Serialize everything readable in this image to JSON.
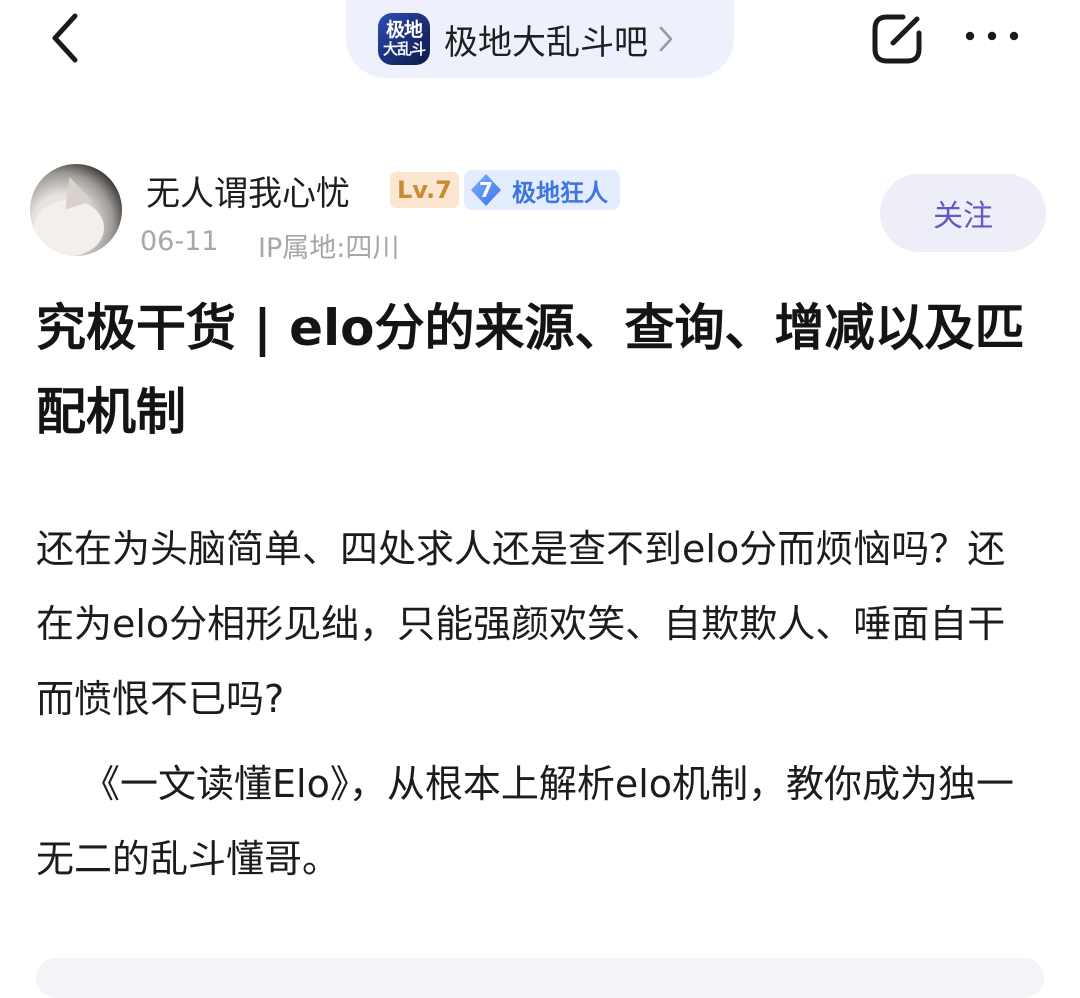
{
  "header": {
    "back_icon": "chevron-left-icon",
    "forum": {
      "logo_line1": "极地",
      "logo_line2": "大乱斗",
      "name": "极地大乱斗吧",
      "chevron_icon": "chevron-right-icon"
    },
    "edit_icon": "share-edit-icon",
    "more_icon": "more-dots-icon"
  },
  "author": {
    "name": "无人谓我心忧",
    "level": "Lv.7",
    "title_badge": {
      "number": "7",
      "text": "极地狂人"
    },
    "date": "06-11",
    "ip_location": "IP属地:四川",
    "follow_label": "关注"
  },
  "post": {
    "title": "究极干货 | elo分的来源、查询、增减以及匹配机制",
    "paragraphs": [
      "还在为头脑简单、四处求人还是查不到elo分而烦恼吗？还在为elo分相形见绌，只能强颜欢笑、自欺欺人、唾面自干而愤恨不已吗?",
      "《一文读懂Elo》，从根本上解析elo机制，教你成为独一无二的乱斗懂哥。"
    ]
  },
  "colors": {
    "accent_follow": "#6259c8",
    "level_badge_bg": "#fbe7cf",
    "level_badge_text": "#c98a36",
    "title_badge_text": "#3e74e3",
    "meta_text": "#a7a7a7"
  }
}
